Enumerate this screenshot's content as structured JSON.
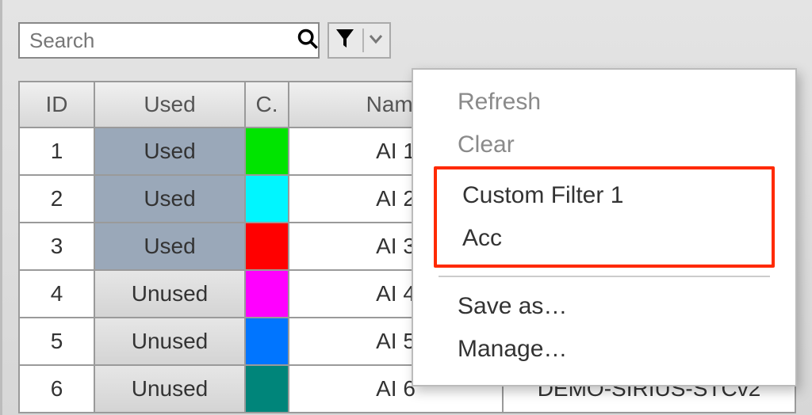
{
  "search": {
    "placeholder": "Search"
  },
  "table": {
    "headers": {
      "id": "ID",
      "used": "Used",
      "c": "C.",
      "name": "Name",
      "rest": ""
    },
    "rows": [
      {
        "id": "1",
        "used": "Used",
        "used_flag": true,
        "color": "#00e400",
        "name": "AI 1",
        "rest": ""
      },
      {
        "id": "2",
        "used": "Used",
        "used_flag": true,
        "color": "#00f6ff",
        "name": "AI 2",
        "rest": ""
      },
      {
        "id": "3",
        "used": "Used",
        "used_flag": true,
        "color": "#ff0000",
        "name": "AI 3",
        "rest": ""
      },
      {
        "id": "4",
        "used": "Unused",
        "used_flag": false,
        "color": "#ff00ff",
        "name": "AI 4",
        "rest": ""
      },
      {
        "id": "5",
        "used": "Unused",
        "used_flag": false,
        "color": "#0075ff",
        "name": "AI 5",
        "rest": ""
      },
      {
        "id": "6",
        "used": "Unused",
        "used_flag": false,
        "color": "#00857a",
        "name": "AI 6",
        "rest": "DEMO-SIRIUS-STCv2"
      }
    ]
  },
  "menu": {
    "refresh": "Refresh",
    "clear": "Clear",
    "custom1": "Custom Filter 1",
    "acc": "Acc",
    "save_as": "Save as…",
    "manage": "Manage…"
  }
}
